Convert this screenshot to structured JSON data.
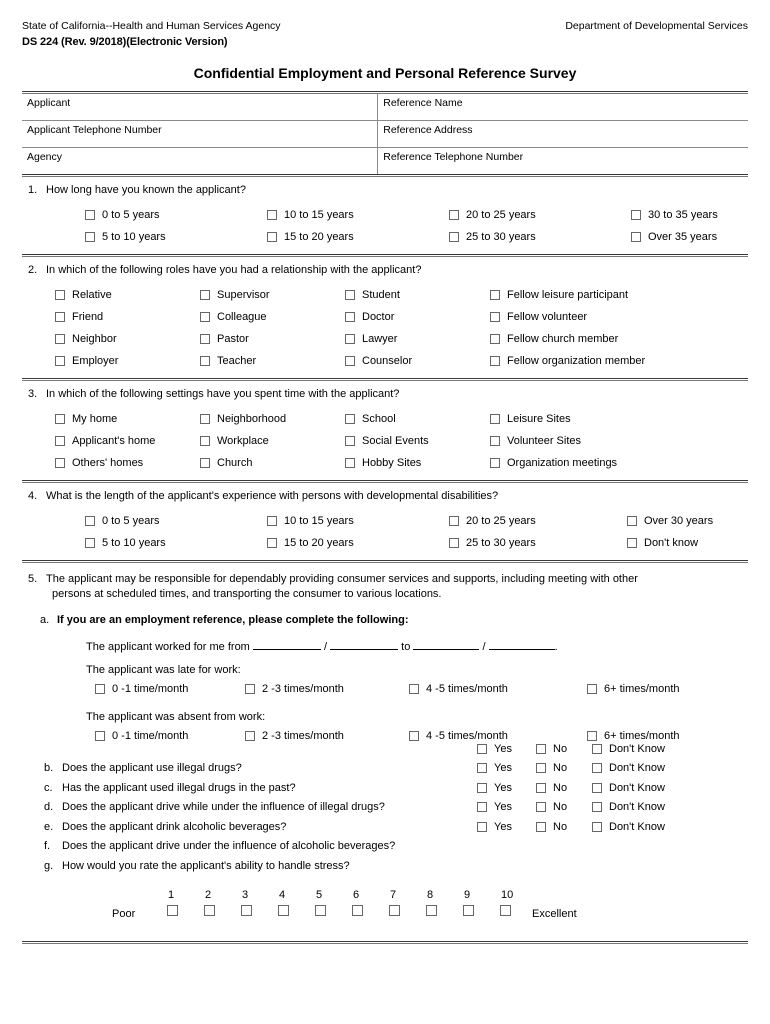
{
  "header": {
    "agency_left": "State of California--Health and Human Services Agency",
    "agency_right": "Department of Developmental Services",
    "form_id": "DS 224 (Rev. 9/2018)(Electronic Version)",
    "title": "Confidential Employment and Personal Reference Survey"
  },
  "info_table": {
    "rows": [
      {
        "left": "Applicant",
        "right": "Reference Name"
      },
      {
        "left": "Applicant Telephone Number",
        "right": "Reference Address"
      },
      {
        "left": "Agency",
        "right": "Reference Telephone Number"
      }
    ]
  },
  "q1": {
    "num": "1.",
    "text": "How long have you known the applicant?",
    "options": [
      "0 to 5 years",
      "10 to 15 years",
      "20 to 25 years",
      "30 to 35 years",
      "5 to 10 years",
      "15 to 20 years",
      "25 to 30 years",
      "Over 35 years"
    ]
  },
  "q2": {
    "num": "2.",
    "text": "In which of the following roles have you had a relationship with the applicant?",
    "options": [
      "Relative",
      "Supervisor",
      "Student",
      "Fellow leisure participant",
      "Friend",
      "Colleague",
      "Doctor",
      "Fellow volunteer",
      "Neighbor",
      "Pastor",
      "Lawyer",
      "Fellow church member",
      "Employer",
      "Teacher",
      "Counselor",
      "Fellow organization member"
    ]
  },
  "q3": {
    "num": "3.",
    "text": "In which of the following settings have you spent time with the applicant?",
    "options": [
      "My home",
      "Neighborhood",
      "School",
      "Leisure Sites",
      "Applicant's home",
      "Workplace",
      "Social Events",
      "Volunteer Sites",
      "Others' homes",
      "Church",
      "Hobby Sites",
      "Organization meetings"
    ]
  },
  "q4": {
    "num": "4.",
    "text": "What is the length of the applicant's experience with persons with developmental disabilities?",
    "options": [
      "0 to 5 years",
      "10 to 15 years",
      "20 to 25 years",
      "Over 30 years",
      "5 to 10 years",
      "15 to 20 years",
      "25 to 30 years",
      "Don't know"
    ]
  },
  "q5": {
    "num": "5.",
    "lead_line1": "The applicant may be responsible for dependably providing consumer services and supports, including meeting with other",
    "lead_line2": "persons at scheduled times, and transporting the consumer to various locations.",
    "a_letter": "a.",
    "a_text": "If you are an employment reference, please complete the following:",
    "worked_prefix": "The applicant worked for me from",
    "worked_slash1": "/",
    "worked_to": "to",
    "worked_slash2": "/",
    "worked_end": ".",
    "late_label": "The applicant was late for work:",
    "absent_label": "The applicant was absent from work:",
    "freq_options": [
      "0 -1 time/month",
      "2 -3 times/month",
      "4 -5 times/month",
      "6+ times/month"
    ],
    "yes_label": "Yes",
    "no_label": "No",
    "dontknow_label": "Don't Know",
    "rows": [
      {
        "letter": "b.",
        "text": "Does the applicant use illegal drugs?"
      },
      {
        "letter": "c.",
        "text": "Has the applicant used illegal drugs in the past?"
      },
      {
        "letter": "d.",
        "text": "Does the applicant drive while under the influence of illegal drugs?"
      },
      {
        "letter": "e.",
        "text": "Does the applicant drink alcoholic beverages?"
      },
      {
        "letter": "f.",
        "text": "Does the applicant drive under the influence of alcoholic beverages?"
      }
    ],
    "g_letter": "g.",
    "g_text": "How would you rate the applicant's ability to handle stress?",
    "rating_low": "Poor",
    "rating_high": "Excellent",
    "rating_numbers": [
      "1",
      "2",
      "3",
      "4",
      "5",
      "6",
      "7",
      "8",
      "9",
      "10"
    ]
  }
}
